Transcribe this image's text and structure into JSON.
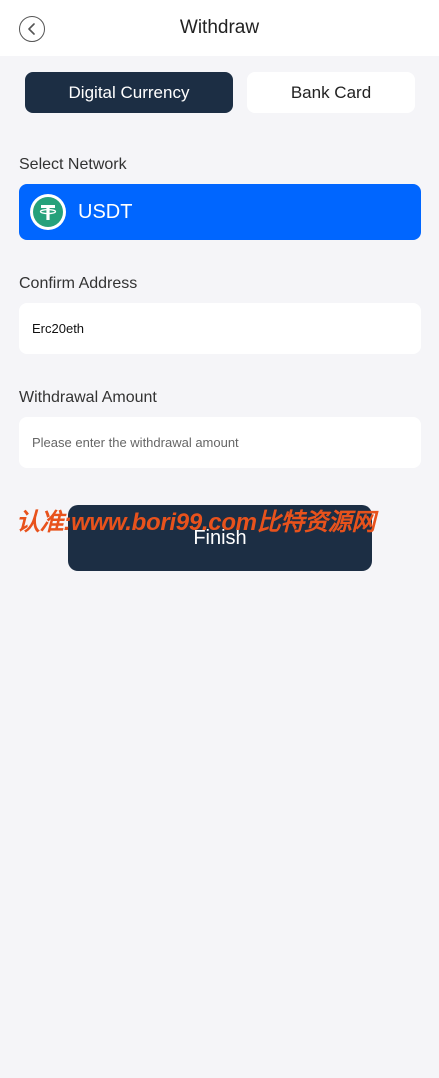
{
  "header": {
    "title": "Withdraw",
    "back_icon": "chevron-left-icon"
  },
  "tabs": [
    {
      "label": "Digital Currency",
      "active": true
    },
    {
      "label": "Bank Card",
      "active": false
    }
  ],
  "network": {
    "label": "Select Network",
    "selected": "USDT",
    "icon": "tether-icon",
    "accent_color": "#0066ff",
    "icon_color": "#26a17b"
  },
  "address": {
    "label": "Confirm Address",
    "value": "Erc20eth"
  },
  "amount": {
    "label": "Withdrawal Amount",
    "placeholder": "Please enter the withdrawal amount"
  },
  "finish_label": "Finish",
  "watermark": "认准:www.bori99.com比特资源网",
  "colors": {
    "primary_dark": "#1c2e44",
    "background": "#f5f5f8",
    "watermark": "#e8521c"
  }
}
